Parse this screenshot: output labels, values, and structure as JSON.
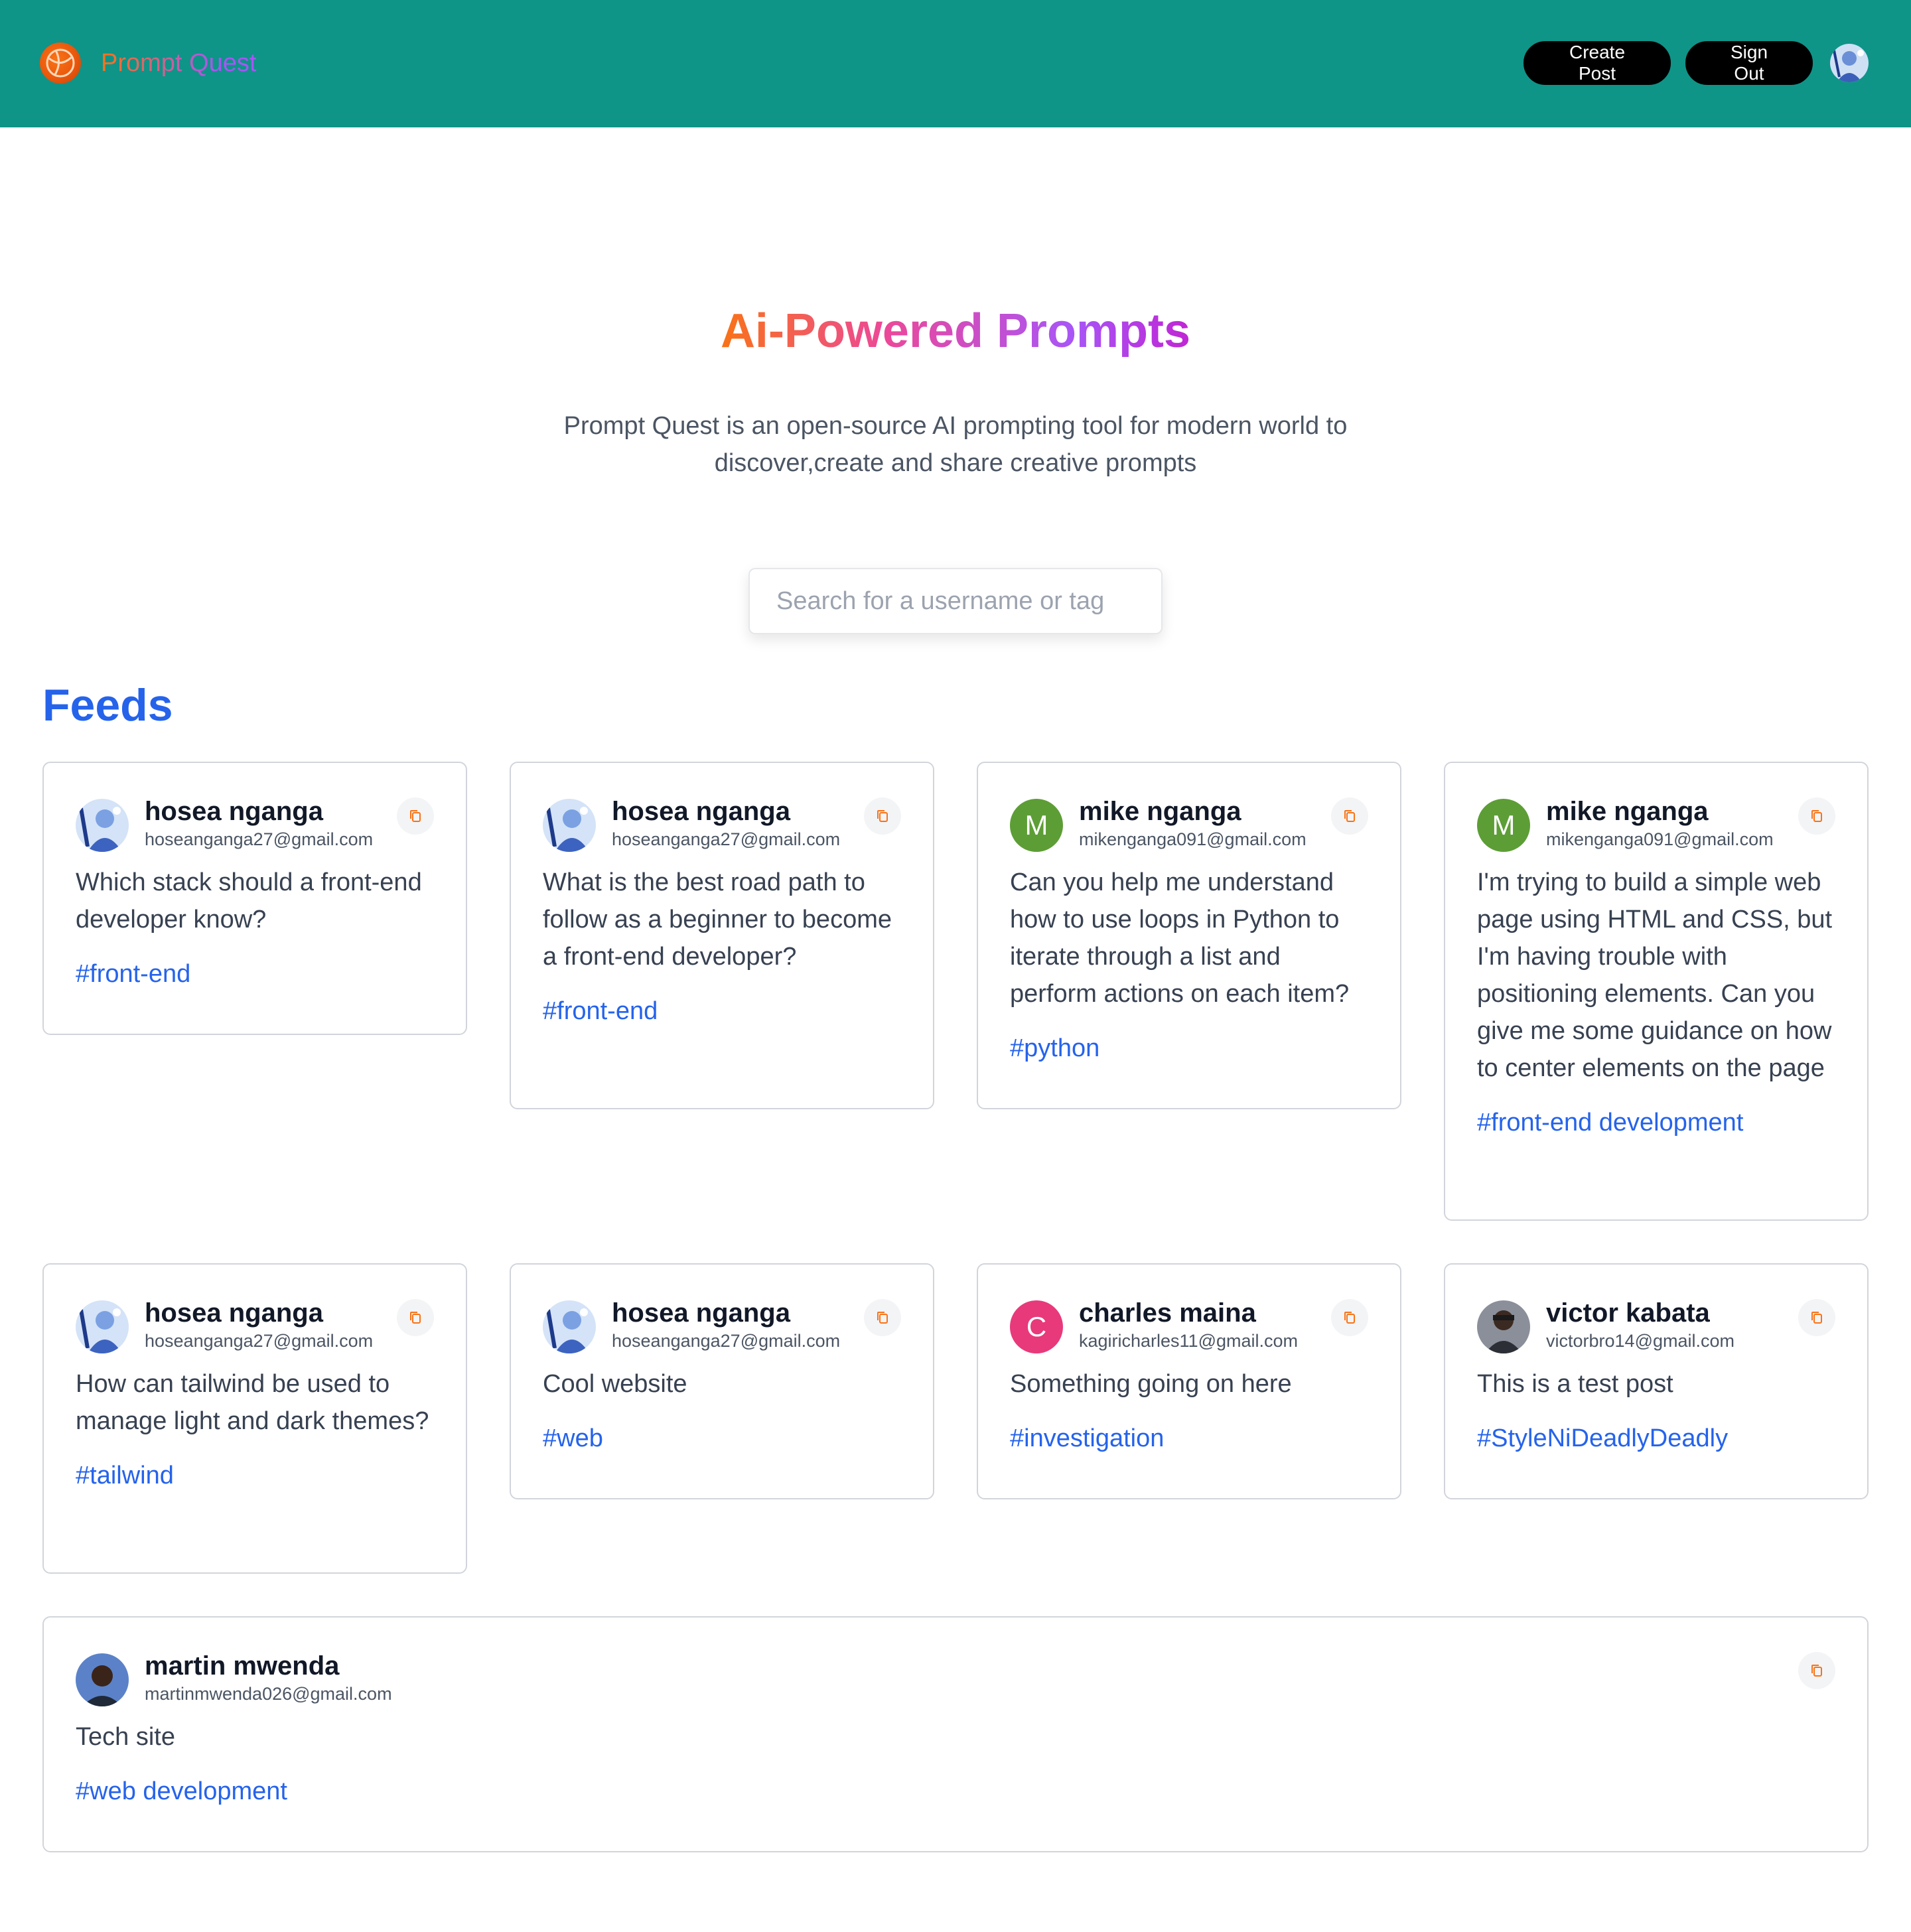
{
  "brand": {
    "name": "Prompt Quest",
    "logo_icon": "globe-logo-icon"
  },
  "nav": {
    "create_label": "Create Post",
    "signout_label": "Sign Out"
  },
  "hero": {
    "title": "Ai-Powered Prompts",
    "description": "Prompt Quest is an open-source AI prompting tool for modern world to discover,create and share creative prompts"
  },
  "search": {
    "placeholder": "Search for a username or tag"
  },
  "feeds": {
    "title": "Feeds",
    "posts": [
      {
        "name": "hosea nganga",
        "email": "hoseanganga27@gmail.com",
        "prompt": "Which stack should a front-end developer know?",
        "tag": "#front-end"
      },
      {
        "name": "hosea nganga",
        "email": "hoseanganga27@gmail.com",
        "prompt": "What is the best road path to follow as a beginner to become a front-end developer?",
        "tag": "#front-end"
      },
      {
        "name": "mike nganga",
        "email": "mikenganga091@gmail.com",
        "initial": "M",
        "prompt": "Can you help me understand how to use loops in Python to iterate through a list and perform actions on each item?",
        "tag": "#python"
      },
      {
        "name": "mike nganga",
        "email": "mikenganga091@gmail.com",
        "initial": "M",
        "prompt": "I'm trying to build a simple web page using HTML and CSS, but I'm having trouble with positioning elements. Can you give me some guidance on how to center elements on the page",
        "tag": "#front-end development"
      },
      {
        "name": "hosea nganga",
        "email": "hoseanganga27@gmail.com",
        "prompt": "How can tailwind be used to manage light and dark themes?",
        "tag": "#tailwind"
      },
      {
        "name": "hosea nganga",
        "email": "hoseanganga27@gmail.com",
        "prompt": "Cool website",
        "tag": "#web"
      },
      {
        "name": "charles maina",
        "email": "kagiricharles11@gmail.com",
        "initial": "C",
        "prompt": "Something going on here",
        "tag": "#investigation"
      },
      {
        "name": "victor kabata",
        "email": "victorbro14@gmail.com",
        "prompt": "This is a test post",
        "tag": "#StyleNiDeadlyDeadly"
      },
      {
        "name": "martin mwenda",
        "email": "martinmwenda026@gmail.com",
        "prompt": "Tech site",
        "tag": "#web development"
      }
    ]
  },
  "colors": {
    "navbar": "#0f9488",
    "accent_blue": "#2563eb",
    "orange": "#f97316",
    "purple": "#a855f7"
  },
  "icons": {
    "copy": "copy-icon"
  }
}
